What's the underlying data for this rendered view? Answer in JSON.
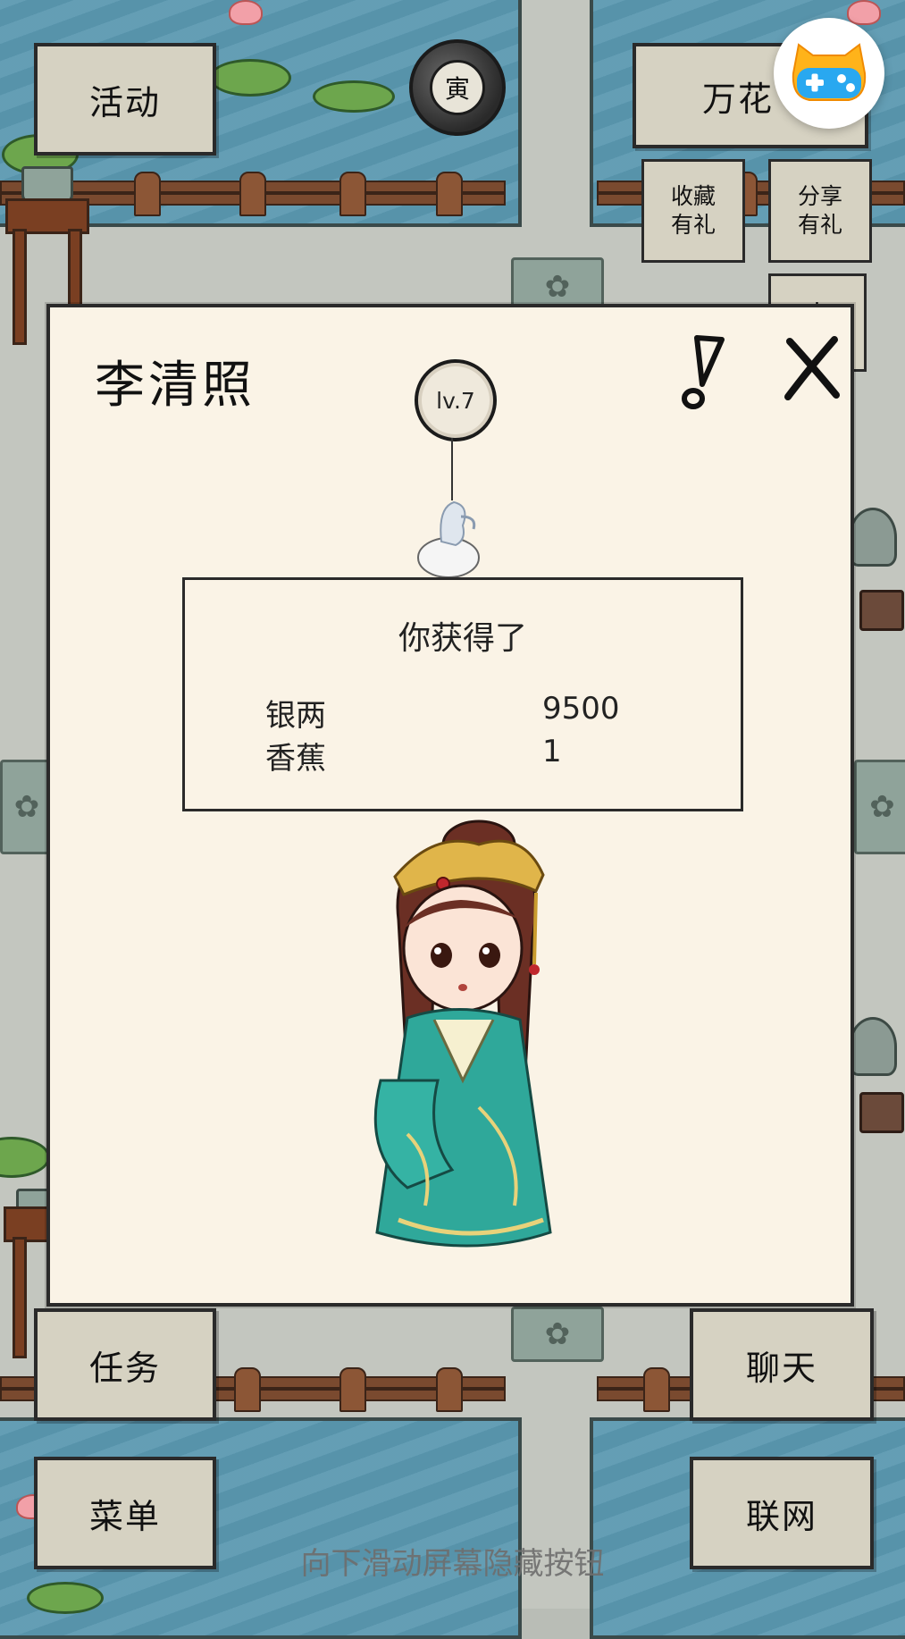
{
  "map_buttons": {
    "activity": "活动",
    "wanhua": "万花",
    "collect_gift": "收藏\n有礼",
    "share_gift": "分享\n有礼",
    "vip": "vip",
    "task": "任务",
    "chat": "聊天",
    "menu": "菜单",
    "online": "联网"
  },
  "zodiac_char": "寅",
  "modal": {
    "character_name": "李清照",
    "level": "lv.7",
    "reward": {
      "heading": "你获得了",
      "items": [
        {
          "name": "银两",
          "amount": "9500"
        },
        {
          "name": "香蕉",
          "amount": "1"
        }
      ]
    }
  },
  "hint": "向下滑动屏幕隐藏按钮"
}
